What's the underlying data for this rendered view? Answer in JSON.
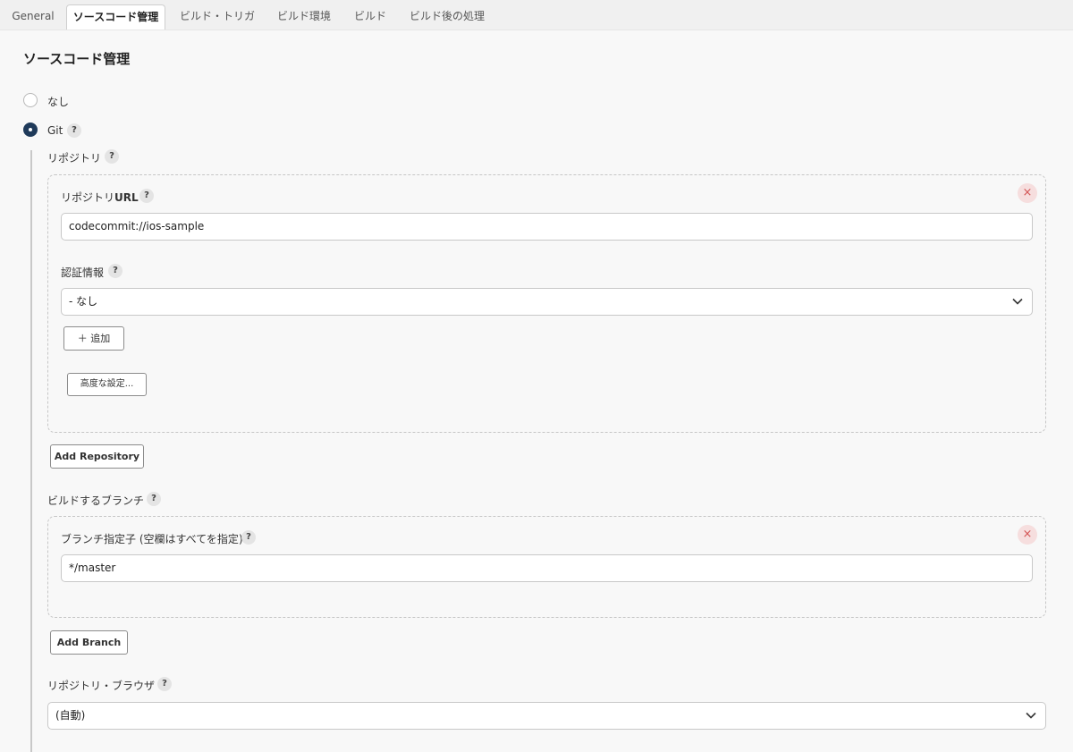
{
  "tabs": [
    {
      "label": "General"
    },
    {
      "label": "ソースコード管理"
    },
    {
      "label": "ビルド・トリガ"
    },
    {
      "label": "ビルド環境"
    },
    {
      "label": "ビルド"
    },
    {
      "label": "ビルド後の処理"
    }
  ],
  "active_tab": "ソースコード管理",
  "section_title": "ソースコード管理",
  "scm": {
    "option_none": "なし",
    "option_git": "Git",
    "selected": "Git"
  },
  "help_symbol": "?",
  "close_symbol": "×",
  "repositories": {
    "label": "リポジトリ",
    "url_label_prefix": "リポジトリ",
    "url_label_suffix": "URL",
    "url_value": "codecommit://ios-sample",
    "credentials_label": "認証情報",
    "credentials_value": "- なし",
    "add_button": "＋ 追加",
    "advanced_button": "高度な設定...",
    "add_repository_button": "Add Repository"
  },
  "branches": {
    "label": "ビルドするブランチ",
    "specifier_label": "ブランチ指定子 (空欄はすべてを指定)",
    "specifier_value": "*/master",
    "add_branch_button": "Add Branch"
  },
  "browser": {
    "label": "リポジトリ・ブラウザ",
    "value": "(自動)"
  },
  "icons": [
    "help-icon",
    "close-icon",
    "chevron-down-icon",
    "radio-icon"
  ]
}
